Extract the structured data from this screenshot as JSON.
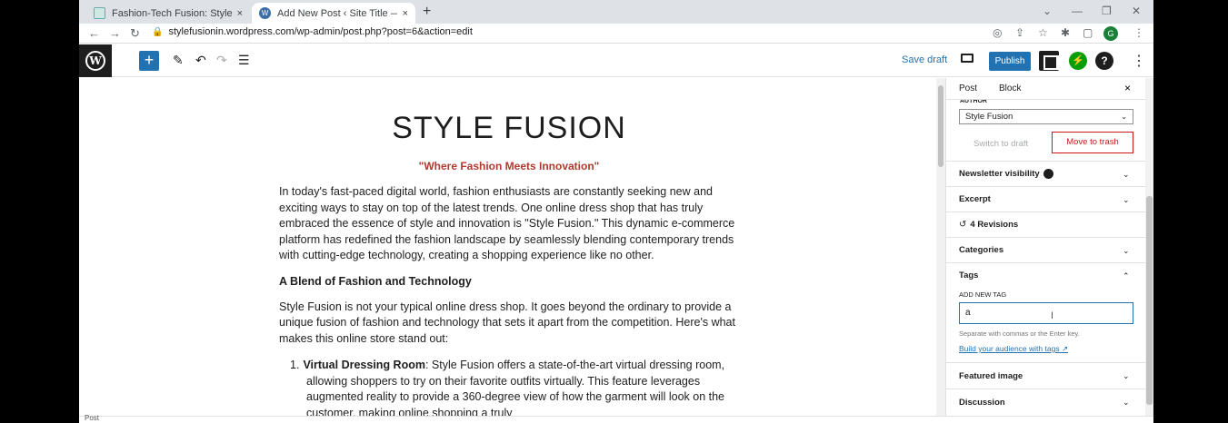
{
  "browser": {
    "tabs": [
      {
        "title": "Fashion-Tech Fusion: Style Revo",
        "close": "×"
      },
      {
        "title": "Add New Post ‹ Site Title — Wo",
        "close": "×"
      }
    ],
    "new_tab": "+",
    "url": "stylefusionin.wordpress.com/wp-admin/post.php?post=6&action=edit",
    "profile_initial": "G"
  },
  "toolbar": {
    "add_label": "+",
    "save_draft": "Save draft",
    "publish": "Publish",
    "help": "?"
  },
  "post": {
    "title": "STYLE FUSION",
    "tagline": "\"Where Fashion Meets Innovation\"",
    "intro": "In today's fast-paced digital world, fashion enthusiasts are constantly seeking new and exciting ways to stay on top of the latest trends. One online dress shop that has truly embraced the essence of style and innovation is \"Style Fusion.\" This dynamic e-commerce platform has redefined the fashion landscape by seamlessly blending contemporary trends with cutting-edge technology, creating a shopping experience like no other.",
    "heading": "A Blend of Fashion and Technology",
    "para2": "Style Fusion is not your typical online dress shop. It goes beyond the ordinary to provide a unique fusion of fashion and technology that sets it apart from the competition. Here's what makes this online store stand out:",
    "list": [
      {
        "num": "1.",
        "bold": "Virtual Dressing Room",
        "text": ": Style Fusion offers a state-of-the-art virtual dressing room, allowing shoppers to try on their favorite outfits virtually. This feature leverages augmented reality to provide a 360-degree view of how the garment will look on the customer, making online shopping a truly"
      }
    ]
  },
  "sidebar": {
    "tab_post": "Post",
    "tab_block": "Block",
    "close": "×",
    "author_label": "AUTHOR",
    "author_value": "Style Fusion",
    "switch_to_draft": "Switch to draft",
    "move_to_trash": "Move to trash",
    "newsletter": "Newsletter visibility",
    "excerpt": "Excerpt",
    "revisions": "4 Revisions",
    "categories": "Categories",
    "tags": "Tags",
    "add_new_tag": "ADD NEW TAG",
    "tag_input_value": "a",
    "tag_help": "Separate with commas or the Enter key.",
    "tag_link": "Build your audience with tags",
    "featured_image": "Featured image",
    "discussion": "Discussion"
  },
  "footer": {
    "label": "Post"
  }
}
